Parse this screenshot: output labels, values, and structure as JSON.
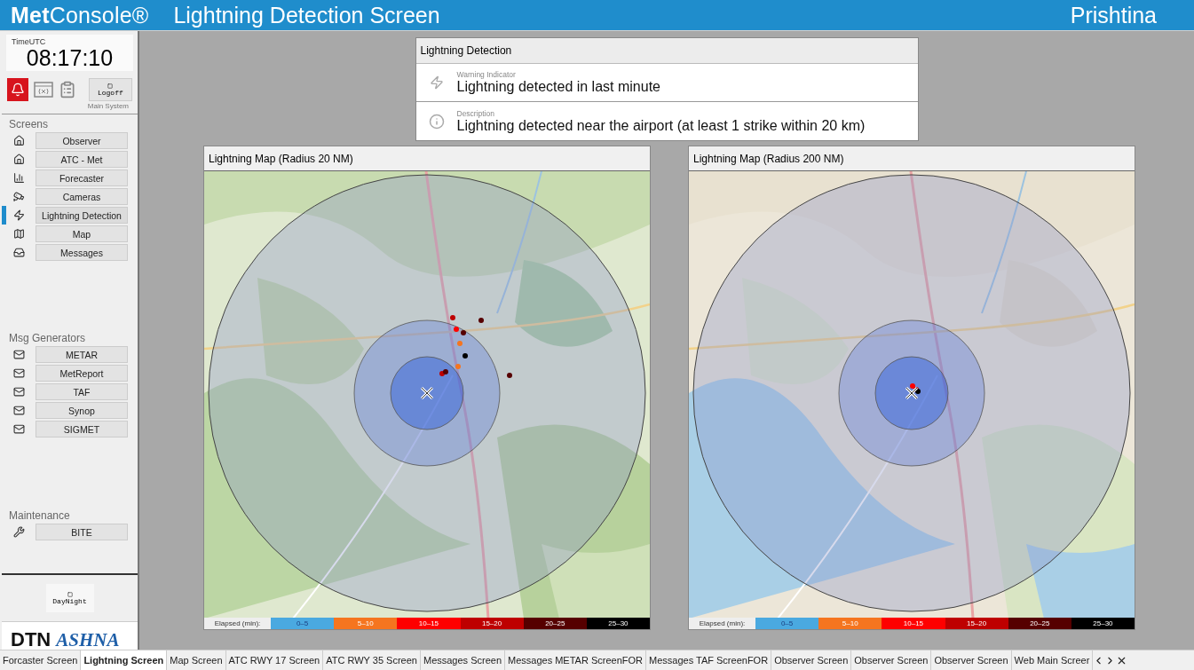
{
  "header": {
    "brand": "**Met**Console®",
    "title": "Lightning Detection Screen",
    "location": "Prishtina"
  },
  "clock": {
    "label": "TimeUTC",
    "time": "08:17:10"
  },
  "toolbar": {
    "alarm_on": true,
    "logoff": "Logoff",
    "system": "Main System"
  },
  "sections": [
    {
      "title": "Screens",
      "items": [
        {
          "label": "Observer",
          "selected": false
        },
        {
          "label": "ATC - Met",
          "selected": false
        },
        {
          "label": "Forecaster",
          "selected": false
        },
        {
          "label": "Cameras",
          "selected": false
        },
        {
          "label": "Lightning Detection",
          "selected": true
        },
        {
          "label": "Map",
          "selected": false
        },
        {
          "label": "Messages",
          "selected": false
        }
      ]
    },
    {
      "title": "Msg Generators",
      "items": [
        {
          "label": "METAR",
          "selected": false
        },
        {
          "label": "MetReport",
          "selected": false
        },
        {
          "label": "TAF",
          "selected": false
        },
        {
          "label": "Synop",
          "selected": false
        },
        {
          "label": "SIGMET",
          "selected": false
        }
      ]
    },
    {
      "title": "Maintenance",
      "items": [
        {
          "label": "BITE",
          "selected": false
        }
      ]
    }
  ],
  "daynight": "DayNight",
  "logo": {
    "left": "DTN",
    "right": "ASHNA"
  },
  "detection": {
    "title": "Lightning Detection",
    "rows": [
      {
        "caption": "Warning Indicator",
        "text": "Lightning detected in last minute"
      },
      {
        "caption": "Description",
        "text": "Lightning detected near the airport (at least 1 strike within 20 km)"
      }
    ]
  },
  "maps": [
    {
      "title": "Lightning Map (Radius 20 NM)",
      "kind": "picture",
      "legend_label": "Elapsed (min):",
      "legend": [
        {
          "label": "0–5",
          "color": "#4aa9e0"
        },
        {
          "label": "5–10",
          "color": "#f5751f"
        },
        {
          "label": "10–15",
          "color": "#fe0000"
        },
        {
          "label": "15–20",
          "color": "#be0000"
        },
        {
          "label": "20–25",
          "color": "#560000"
        },
        {
          "label": "25–30",
          "color": "#000000"
        }
      ]
    },
    {
      "title": "Lightning Map (Radius 200 NM)",
      "kind": "picture",
      "legend_label": "Elapsed (min):",
      "legend": [
        {
          "label": "0–5",
          "color": "#4aa9e0"
        },
        {
          "label": "5–10",
          "color": "#f5751f"
        },
        {
          "label": "10–15",
          "color": "#fe0000"
        },
        {
          "label": "15–20",
          "color": "#be0000"
        },
        {
          "label": "20–25",
          "color": "#560000"
        },
        {
          "label": "25–30",
          "color": "#000000"
        }
      ]
    }
  ],
  "tabs": [
    {
      "label": "Forcaster Screen",
      "selected": false
    },
    {
      "label": "Lightning Screen",
      "selected": true
    },
    {
      "label": "Map Screen",
      "selected": false
    },
    {
      "label": "ATC RWY 17 Screen",
      "selected": false
    },
    {
      "label": "ATC RWY 35 Screen",
      "selected": false
    },
    {
      "label": "Messages Screen",
      "selected": false
    },
    {
      "label": "Messages METAR ScreenFOR",
      "selected": false
    },
    {
      "label": "Messages TAF ScreenFOR",
      "selected": false
    },
    {
      "label": "Observer Screen",
      "selected": false
    },
    {
      "label": "Observer Screen",
      "selected": false
    },
    {
      "label": "Observer Screen",
      "selected": false
    },
    {
      "label": "Web Main Screer",
      "selected": false
    }
  ]
}
